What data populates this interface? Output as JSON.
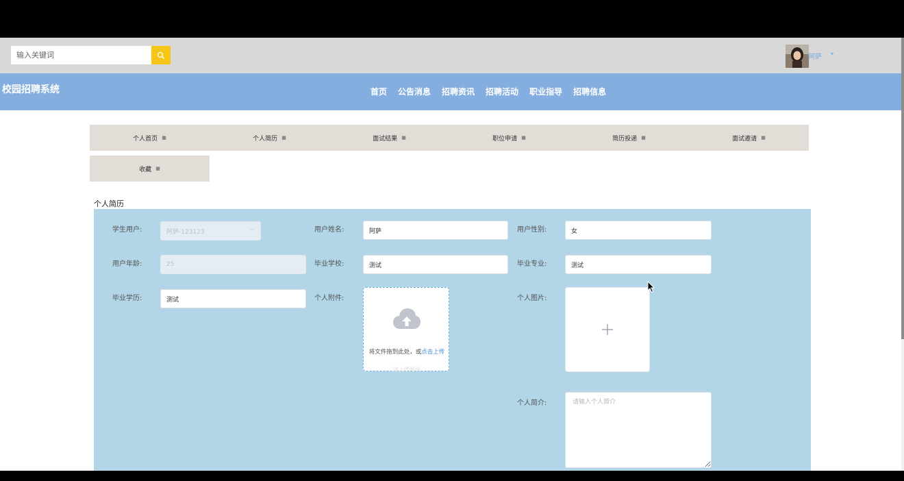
{
  "header": {
    "search_placeholder": "输入关键词",
    "user_name": "阿萨",
    "caret": "▾"
  },
  "nav": {
    "site_title": "校园招聘系统",
    "items": [
      "首页",
      "公告消息",
      "招聘资讯",
      "招聘活动",
      "职业指导",
      "招聘信息"
    ]
  },
  "sub_menu": {
    "items": [
      "个人首页",
      "个人简历",
      "面试结果",
      "职位申请",
      "简历投递",
      "面试邀请",
      "收藏"
    ]
  },
  "page": {
    "section_title": "个人简历"
  },
  "form": {
    "student_label": "学生用户:",
    "student_value": "阿萨-123123",
    "name_label": "用户姓名:",
    "name_value": "阿萨",
    "gender_label": "用户性别:",
    "gender_value": "女",
    "age_label": "用户年龄:",
    "age_value": "25",
    "school_label": "毕业学校:",
    "school_value": "测试",
    "major_label": "毕业专业:",
    "major_value": "测试",
    "degree_label": "毕业学历:",
    "degree_value": "测试",
    "attachment_label": "个人附件:",
    "upload_text": "将文件拖到此处，或",
    "upload_link": "点击上传",
    "upload_tip": "请上传附件",
    "photo_label": "个人图片:",
    "intro_label": "个人简介:",
    "intro_placeholder": "请输入个人简介"
  },
  "colors": {
    "topbar": "#d8d8d8",
    "nav": "#84aedf",
    "search_button": "#f5c518",
    "sub_menu": "#e2ddd7",
    "form_panel": "#b2d5e8",
    "link": "#4a8fe0"
  }
}
